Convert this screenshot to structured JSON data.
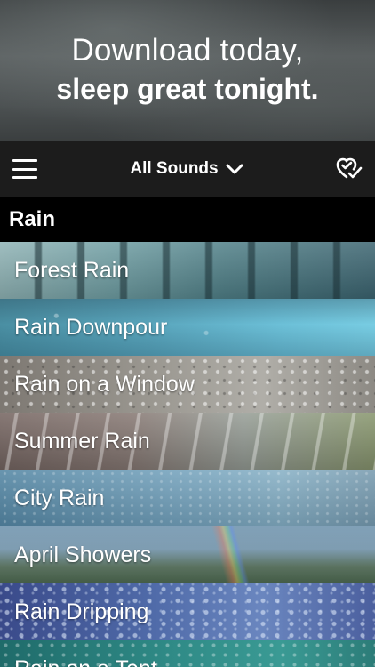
{
  "promo": {
    "line1": "Download today,",
    "line2": "sleep great tonight."
  },
  "navbar": {
    "title": "All Sounds",
    "menu_icon": "hamburger-menu-icon",
    "dropdown_icon": "chevron-down-icon",
    "favorites_icon": "heart-check-icon"
  },
  "section": {
    "title": "Rain"
  },
  "sounds": [
    {
      "label": "Forest Rain"
    },
    {
      "label": "Rain Downpour"
    },
    {
      "label": "Rain on a Window"
    },
    {
      "label": "Summer Rain"
    },
    {
      "label": "City Rain"
    },
    {
      "label": "April Showers"
    },
    {
      "label": "Rain Dripping"
    },
    {
      "label": "Rain on a Tent"
    }
  ],
  "colors": {
    "navbar_bg": "#1c1c1c",
    "section_bg": "#000000",
    "text": "#ffffff"
  }
}
